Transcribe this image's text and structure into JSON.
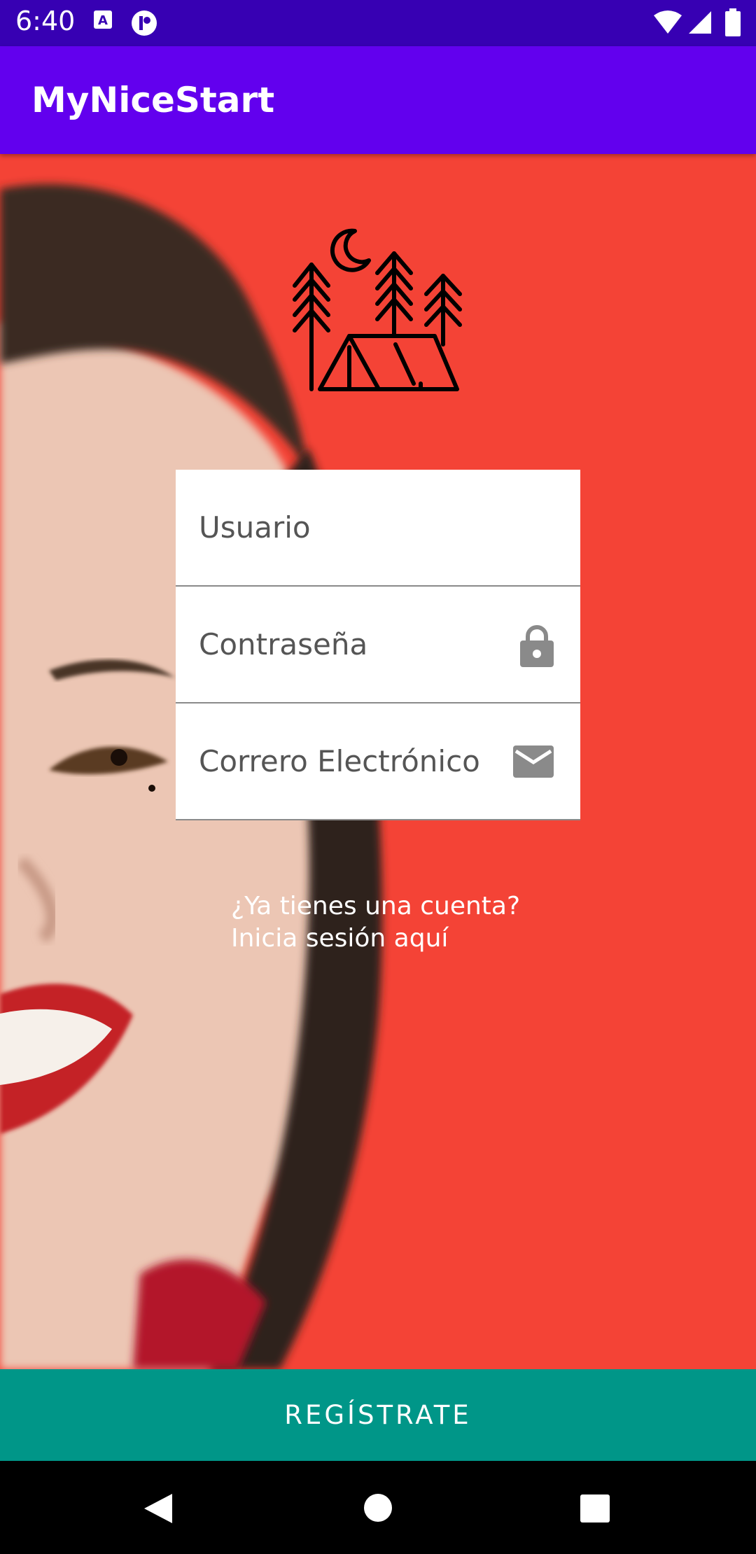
{
  "status_bar": {
    "time": "6:40",
    "icons": [
      "a-notification-icon",
      "p-notification-icon",
      "wifi-icon",
      "signal-icon",
      "battery-icon"
    ]
  },
  "app_bar": {
    "title": "MyNiceStart"
  },
  "colors": {
    "status_bar": "#3700B3",
    "app_bar": "#6200EE",
    "background": "#F44336",
    "register_button": "#009688"
  },
  "logo": {
    "icon": "camping-tent-moon-trees-icon"
  },
  "form": {
    "username": {
      "placeholder": "Usuario"
    },
    "password": {
      "placeholder": "Contraseña",
      "icon": "lock-icon"
    },
    "email": {
      "placeholder": "Correro Electrónico",
      "icon": "mail-icon"
    }
  },
  "login_link": {
    "line1": "¿Ya tienes una cuenta?",
    "line2": "Inicia sesión aquí"
  },
  "register_button": {
    "label": "REGÍSTRATE"
  },
  "nav_bar": {
    "icons": [
      "back-icon",
      "home-icon",
      "recents-icon"
    ]
  }
}
